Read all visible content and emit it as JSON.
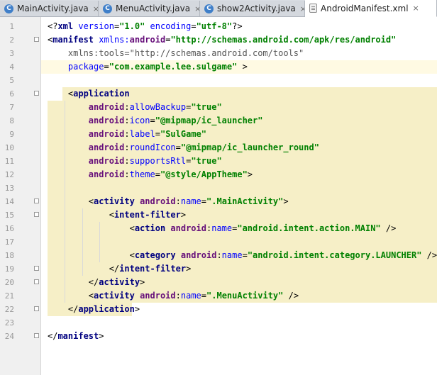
{
  "tabs": [
    {
      "label": "MainActivity.java",
      "icon": "java-class-icon",
      "icon_glyph": "C",
      "active": false
    },
    {
      "label": "MenuActivity.java",
      "icon": "java-class-icon",
      "icon_glyph": "C",
      "active": false
    },
    {
      "label": "show2Activity.java",
      "icon": "java-class-icon",
      "icon_glyph": "C",
      "active": false
    },
    {
      "label": "AndroidManifest.xml",
      "icon": "xml-file-icon",
      "icon_glyph": "",
      "active": true
    }
  ],
  "close_glyph": "×",
  "editor": {
    "current_line": 4,
    "lines": [
      {
        "n": "1",
        "tokens": [
          [
            "plain",
            "<?"
          ],
          [
            "tag",
            "xml "
          ],
          [
            "attr",
            "version"
          ],
          [
            "plain",
            "="
          ],
          [
            "val",
            "\"1.0\" "
          ],
          [
            "attr",
            "encoding"
          ],
          [
            "plain",
            "="
          ],
          [
            "val",
            "\"utf-8\""
          ],
          [
            "plain",
            "?>"
          ]
        ]
      },
      {
        "n": "2",
        "tokens": [
          [
            "plain",
            "<"
          ],
          [
            "tag",
            "manifest "
          ],
          [
            "attr",
            "xmlns:"
          ],
          [
            "ns",
            "android"
          ],
          [
            "plain",
            "="
          ],
          [
            "val",
            "\"http://schemas.android.com/apk/res/android\""
          ]
        ]
      },
      {
        "n": "3",
        "tokens": [
          [
            "gray",
            "    xmlns:tools=\"http://schemas.android.com/tools\""
          ]
        ]
      },
      {
        "n": "4",
        "tokens": [
          [
            "attr",
            "    package"
          ],
          [
            "plain",
            "="
          ],
          [
            "val",
            "\"com.example.lee.sulgame\""
          ],
          [
            "plain",
            " >"
          ]
        ]
      },
      {
        "n": "5",
        "tokens": []
      },
      {
        "n": "6",
        "tokens": [
          [
            "plain",
            "    <"
          ],
          [
            "tag",
            "application"
          ]
        ]
      },
      {
        "n": "7",
        "tokens": [
          [
            "ns",
            "        android"
          ],
          [
            "plain",
            ":"
          ],
          [
            "attr",
            "allowBackup"
          ],
          [
            "plain",
            "="
          ],
          [
            "val",
            "\"true\""
          ]
        ]
      },
      {
        "n": "8",
        "tokens": [
          [
            "ns",
            "        android"
          ],
          [
            "plain",
            ":"
          ],
          [
            "attr",
            "icon"
          ],
          [
            "plain",
            "="
          ],
          [
            "val",
            "\"@mipmap/ic_launcher\""
          ]
        ]
      },
      {
        "n": "9",
        "tokens": [
          [
            "ns",
            "        android"
          ],
          [
            "plain",
            ":"
          ],
          [
            "attr",
            "label"
          ],
          [
            "plain",
            "="
          ],
          [
            "val",
            "\"SulGame\""
          ]
        ]
      },
      {
        "n": "10",
        "tokens": [
          [
            "ns",
            "        android"
          ],
          [
            "plain",
            ":"
          ],
          [
            "attr",
            "roundIcon"
          ],
          [
            "plain",
            "="
          ],
          [
            "val",
            "\"@mipmap/ic_launcher_round\""
          ]
        ]
      },
      {
        "n": "11",
        "tokens": [
          [
            "ns",
            "        android"
          ],
          [
            "plain",
            ":"
          ],
          [
            "attr",
            "supportsRtl"
          ],
          [
            "plain",
            "="
          ],
          [
            "val",
            "\"true\""
          ]
        ]
      },
      {
        "n": "12",
        "tokens": [
          [
            "ns",
            "        android"
          ],
          [
            "plain",
            ":"
          ],
          [
            "attr",
            "theme"
          ],
          [
            "plain",
            "="
          ],
          [
            "val",
            "\"@style/AppTheme\""
          ],
          [
            "plain",
            ">"
          ]
        ]
      },
      {
        "n": "13",
        "tokens": []
      },
      {
        "n": "14",
        "tokens": [
          [
            "plain",
            "        <"
          ],
          [
            "tag",
            "activity "
          ],
          [
            "ns",
            "android"
          ],
          [
            "plain",
            ":"
          ],
          [
            "attr",
            "name"
          ],
          [
            "plain",
            "="
          ],
          [
            "val",
            "\".MainActivity\""
          ],
          [
            "plain",
            ">"
          ]
        ]
      },
      {
        "n": "15",
        "tokens": [
          [
            "plain",
            "            <"
          ],
          [
            "tag",
            "intent-filter"
          ],
          [
            "plain",
            ">"
          ]
        ]
      },
      {
        "n": "16",
        "tokens": [
          [
            "plain",
            "                <"
          ],
          [
            "tag",
            "action "
          ],
          [
            "ns",
            "android"
          ],
          [
            "plain",
            ":"
          ],
          [
            "attr",
            "name"
          ],
          [
            "plain",
            "="
          ],
          [
            "val",
            "\"android.intent.action.MAIN\""
          ],
          [
            "plain",
            " />"
          ]
        ]
      },
      {
        "n": "17",
        "tokens": []
      },
      {
        "n": "18",
        "tokens": [
          [
            "plain",
            "                <"
          ],
          [
            "tag",
            "category "
          ],
          [
            "ns",
            "android"
          ],
          [
            "plain",
            ":"
          ],
          [
            "attr",
            "name"
          ],
          [
            "plain",
            "="
          ],
          [
            "val",
            "\"android.intent.category.LAUNCHER\""
          ],
          [
            "plain",
            " />"
          ]
        ]
      },
      {
        "n": "19",
        "tokens": [
          [
            "plain",
            "            </"
          ],
          [
            "tag",
            "intent-filter"
          ],
          [
            "plain",
            ">"
          ]
        ]
      },
      {
        "n": "20",
        "tokens": [
          [
            "plain",
            "        </"
          ],
          [
            "tag",
            "activity"
          ],
          [
            "plain",
            ">"
          ]
        ]
      },
      {
        "n": "21",
        "tokens": [
          [
            "plain",
            "        <"
          ],
          [
            "tag",
            "activity "
          ],
          [
            "ns",
            "android"
          ],
          [
            "plain",
            ":"
          ],
          [
            "attr",
            "name"
          ],
          [
            "plain",
            "="
          ],
          [
            "val",
            "\".MenuActivity\""
          ],
          [
            "plain",
            " />"
          ]
        ]
      },
      {
        "n": "22",
        "tokens": [
          [
            "plain",
            "    </"
          ],
          [
            "tag",
            "application"
          ],
          [
            "plain",
            ">"
          ]
        ]
      },
      {
        "n": "23",
        "tokens": []
      },
      {
        "n": "24",
        "tokens": [
          [
            "plain",
            "</"
          ],
          [
            "tag",
            "manifest"
          ],
          [
            "plain",
            ">"
          ]
        ]
      }
    ]
  },
  "colors": {
    "tag": "#000080",
    "namespace": "#660e7a",
    "attribute": "#0000ff",
    "value": "#008000",
    "highlight_block": "#f6efc7",
    "current_line": "#fffae3"
  }
}
